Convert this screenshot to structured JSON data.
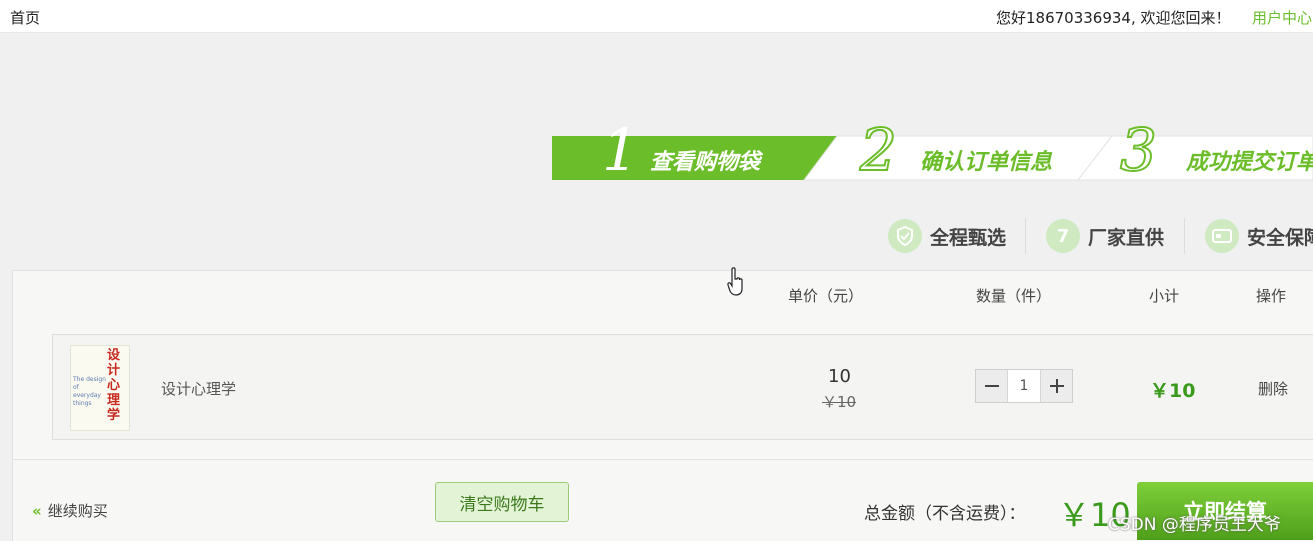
{
  "topbar": {
    "home": "首页",
    "greeting": "您好18670336934, 欢迎您回来！",
    "user_center": "用户中心"
  },
  "steps": [
    {
      "num": "1",
      "label": "查看购物袋"
    },
    {
      "num": "2",
      "label": "确认订单信息"
    },
    {
      "num": "3",
      "label": "成功提交订单"
    }
  ],
  "features": [
    {
      "icon": "shield-check-icon",
      "label": "全程甄选"
    },
    {
      "icon": "seven-icon",
      "label": "厂家直供",
      "glyph": "7"
    },
    {
      "icon": "card-icon",
      "label": "安全保障"
    }
  ],
  "table": {
    "headers": [
      "单价（元）",
      "数量（件）",
      "小计",
      "操作"
    ]
  },
  "item": {
    "cover_title": "设计心理学",
    "cover_subtitle": "The design of everyday things",
    "name": "设计心理学",
    "price": "10",
    "old_price": "￥10",
    "quantity": "1",
    "subtotal": "￥10",
    "delete": "删除"
  },
  "footer": {
    "continue": "继续购买",
    "clear": "清空购物车",
    "total_label": "总金额（不含运费）：",
    "total": "￥10",
    "checkout": "立即结算"
  },
  "watermark": "CSDN @程序员王大爷",
  "colors": {
    "accent": "#6cbd2a",
    "price": "#3a9a1c"
  }
}
